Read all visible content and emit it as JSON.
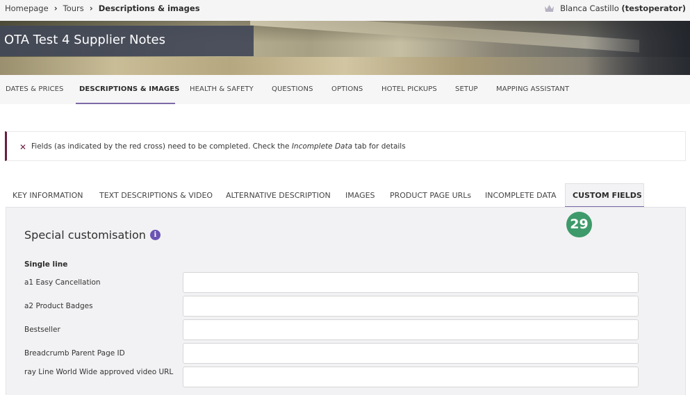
{
  "breadcrumb": {
    "home": "Homepage",
    "tours": "Tours",
    "current": "Descriptions & images"
  },
  "user": {
    "name": "Blanca Castillo",
    "login": "(testoperator)"
  },
  "hero": {
    "title": "OTA Test 4 Supplier Notes"
  },
  "main_nav": {
    "items": [
      "DATES & PRICES",
      "DESCRIPTIONS & IMAGES",
      "HEALTH & SAFETY",
      "QUESTIONS",
      "OPTIONS",
      "HOTEL PICKUPS",
      "SETUP",
      "MAPPING ASSISTANT"
    ],
    "active": "DESCRIPTIONS & IMAGES"
  },
  "alert": {
    "icon": "✕",
    "text_before": "Fields (as indicated by the red cross) need to be completed. Check the ",
    "text_italic": "Incomplete Data",
    "text_after": " tab for details"
  },
  "tabs": {
    "items": [
      "KEY INFORMATION",
      "TEXT DESCRIPTIONS & VIDEO",
      "ALTERNATIVE DESCRIPTION",
      "IMAGES",
      "PRODUCT PAGE URLs",
      "INCOMPLETE DATA",
      "CUSTOM FIELDS"
    ],
    "active": "CUSTOM FIELDS"
  },
  "step_badge": "29",
  "section": {
    "title": "Special customisation",
    "info_icon": "i",
    "group_label": "Single line",
    "fields": [
      {
        "label": "a1 Easy Cancellation",
        "value": ""
      },
      {
        "label": "a2 Product Badges",
        "value": ""
      },
      {
        "label": "Bestseller",
        "value": ""
      },
      {
        "label": "Breadcrumb Parent Page ID",
        "value": ""
      },
      {
        "label": "ray Line World Wide approved video URL",
        "value": ""
      }
    ]
  },
  "colors": {
    "accent": "#7b6aa8",
    "alert_border": "#6b1d3f",
    "badge": "#3e9a6a",
    "info_icon": "#6b54b3",
    "title_box": "#424858"
  }
}
